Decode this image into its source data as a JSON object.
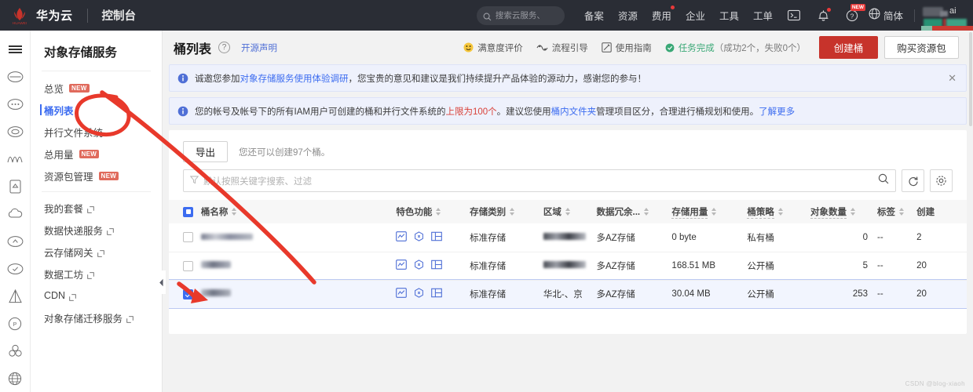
{
  "topnav": {
    "brand": "华为云",
    "console": "控制台",
    "search_placeholder": "搜索云服务、",
    "items": [
      {
        "label": "备案",
        "dot": false
      },
      {
        "label": "资源",
        "dot": false
      },
      {
        "label": "费用",
        "dot": true
      },
      {
        "label": "企业",
        "dot": false
      },
      {
        "label": "工具",
        "dot": false
      },
      {
        "label": "工单",
        "dot": false
      }
    ],
    "icons": [
      {
        "name": "cloudshell-icon",
        "dot": false,
        "new": false
      },
      {
        "name": "bell-icon",
        "dot": true,
        "new": false
      },
      {
        "name": "help-icon",
        "dot": false,
        "new": true,
        "new_label": "NEW"
      }
    ],
    "lang": "简体",
    "avatar_text": "ai"
  },
  "rail": {
    "menu_icon": "hamburger-icon",
    "icons": [
      "cloud-server-icon",
      "cloud-dots-icon",
      "cloud-stack-icon",
      "wave-icon",
      "document-icon",
      "cloud-outline-icon",
      "cloud-upload-icon",
      "cloud-check-icon",
      "triangle-prism-icon",
      "ip-circle-icon",
      "cluster-icon",
      "globe-web-icon"
    ]
  },
  "sidebar": {
    "title": "对象存储服务",
    "items": [
      {
        "label": "总览",
        "badge": "NEW",
        "external": false,
        "active": false
      },
      {
        "label": "桶列表",
        "badge": "",
        "external": false,
        "active": true
      },
      {
        "label": "并行文件系统",
        "badge": "",
        "external": false,
        "active": false
      },
      {
        "label": "总用量",
        "badge": "NEW",
        "external": false,
        "active": false
      },
      {
        "label": "资源包管理",
        "badge": "NEW",
        "external": false,
        "active": false
      },
      {
        "label": "我的套餐",
        "badge": "",
        "external": true,
        "active": false
      },
      {
        "label": "数据快递服务",
        "badge": "",
        "external": true,
        "active": false
      },
      {
        "label": "云存储网关",
        "badge": "",
        "external": true,
        "active": false
      },
      {
        "label": "数据工坊",
        "badge": "",
        "external": true,
        "active": false
      },
      {
        "label": "CDN",
        "badge": "",
        "external": true,
        "active": false
      },
      {
        "label": "对象存储迁移服务",
        "badge": "",
        "external": true,
        "active": false
      }
    ]
  },
  "page": {
    "title": "桶列表",
    "help_icon": "question-mark-icon",
    "open_source_link": "开源声明",
    "actions": [
      {
        "label": "满意度评价",
        "icon": "smiley-icon"
      },
      {
        "label": "流程引导",
        "icon": "flow-guide-icon"
      },
      {
        "label": "使用指南",
        "icon": "guide-book-icon"
      }
    ],
    "task_status_main": "任务完成",
    "task_status_detail": "（成功2个，失败0个）",
    "create_bucket_button": "创建桶",
    "buy_package_button": "购买资源包"
  },
  "banners": [
    {
      "icon": "info-icon",
      "prefix": "诚邀您参加",
      "link": "对象存储服务使用体验调研",
      "suffix": "，您宝贵的意见和建议是我们持续提升产品体验的源动力，感谢您的参与！",
      "closable": true,
      "close_label": "✕"
    },
    {
      "icon": "info-icon",
      "prefix": "您的帐号及帐号下的所有IAM用户可创建的桶和并行文件系统的",
      "highlight": "上限为100个",
      "middle": "。建议您使用",
      "link": "桶内文件夹",
      "suffix": "管理项目区分，合理进行桶规划和使用。",
      "tail_link": "了解更多",
      "closable": false
    }
  ],
  "toolbar": {
    "export_button": "导出",
    "quota_tip": "您还可以创建97个桶。",
    "search_placeholder": "默认按照关键字搜索、过滤",
    "filter_icon": "filter-icon",
    "search_icon": "search-icon",
    "refresh_icon": "refresh-icon",
    "settings_icon": "gear-icon"
  },
  "table": {
    "select_all_state": "partial",
    "columns": [
      {
        "label": "桶名称",
        "sortable": true,
        "dashed": false
      },
      {
        "label": "特色功能",
        "sortable": true,
        "dashed": false
      },
      {
        "label": "存储类别",
        "sortable": true,
        "dashed": false
      },
      {
        "label": "区域",
        "sortable": true,
        "dashed": false
      },
      {
        "label": "数据冗余...",
        "sortable": true,
        "dashed": false
      },
      {
        "label": "存储用量",
        "sortable": true,
        "dashed": true
      },
      {
        "label": "桶策略",
        "sortable": true,
        "dashed": true
      },
      {
        "label": "对象数量",
        "sortable": true,
        "dashed": true
      },
      {
        "label": "标签",
        "sortable": true,
        "dashed": false
      },
      {
        "label": "创建",
        "sortable": false,
        "dashed": false
      }
    ],
    "rows": [
      {
        "selected": false,
        "name": "",
        "name_redacted": true,
        "features": [
          "monitor-icon",
          "cdn-icon",
          "layout-icon"
        ],
        "storage_class": "标准存储",
        "region": "",
        "region_redacted": true,
        "redundancy": "多AZ存储",
        "usage": "0 byte",
        "policy": "私有桶",
        "policy_public": false,
        "objects": "0",
        "tags": "--",
        "created": "2"
      },
      {
        "selected": false,
        "name": "",
        "name_redacted": true,
        "features": [
          "monitor-icon",
          "cdn-icon",
          "layout-icon"
        ],
        "storage_class": "标准存储",
        "region": "华北-北京",
        "region_redacted": true,
        "redundancy": "多AZ存储",
        "usage": "168.51 MB",
        "policy": "公开桶",
        "policy_public": true,
        "objects": "5",
        "tags": "--",
        "created": "20"
      },
      {
        "selected": true,
        "name": "",
        "name_redacted": true,
        "features": [
          "monitor-icon",
          "cdn-icon",
          "layout-icon"
        ],
        "storage_class": "标准存储",
        "region": "华北-、京",
        "region_redacted": true,
        "redundancy": "多AZ存储",
        "usage": "30.04 MB",
        "policy": "公开桶",
        "policy_public": true,
        "objects": "253",
        "tags": "--",
        "created": "20"
      }
    ]
  },
  "watermark": "CSDN @blog-xiaoh",
  "colors": {
    "brand_red": "#c7332b",
    "accent_blue": "#3c6cf0",
    "banner_bg": "#eef1fc",
    "topnav_bg": "#2a2d35",
    "badge_red": "#e06a5c",
    "annotation_red": "#e8392b",
    "success_green": "#3aa876"
  }
}
